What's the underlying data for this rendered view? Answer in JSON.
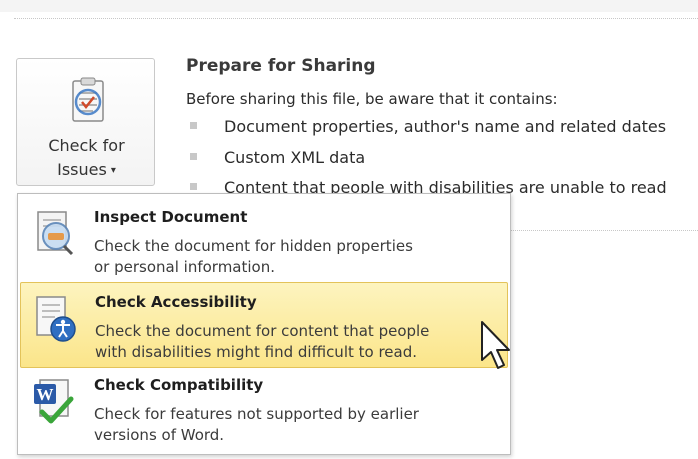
{
  "check_for_issues": {
    "label_line1": "Check for",
    "label_line2": "Issues",
    "caret": "▾",
    "icon": "checklist-icon"
  },
  "prepare_for_sharing": {
    "title": "Prepare for Sharing",
    "subtitle": "Before sharing this file, be aware that it contains:",
    "bullets": [
      "Document properties, author's name and related dates",
      "Custom XML data",
      "Content that people with disabilities are unable to read"
    ]
  },
  "menu": {
    "items": [
      {
        "title": "Inspect Document",
        "desc_line1": "Check the document for hidden properties",
        "desc_line2": "or personal information.",
        "icon": "inspect-document-icon",
        "highlighted": false
      },
      {
        "title": "Check Accessibility",
        "desc_line1": "Check the document for content that people",
        "desc_line2": "with disabilities might find difficult to read.",
        "icon": "accessibility-icon",
        "highlighted": true
      },
      {
        "title": "Check Compatibility",
        "desc_line1": "Check for features not supported by earlier",
        "desc_line2": "versions of Word.",
        "icon": "word-compatibility-icon",
        "highlighted": false
      }
    ]
  },
  "colors": {
    "highlight": "#fbe58a",
    "highlight_border": "#e3c35a",
    "word_blue": "#2b5aa8",
    "check_green": "#3aa53a"
  }
}
